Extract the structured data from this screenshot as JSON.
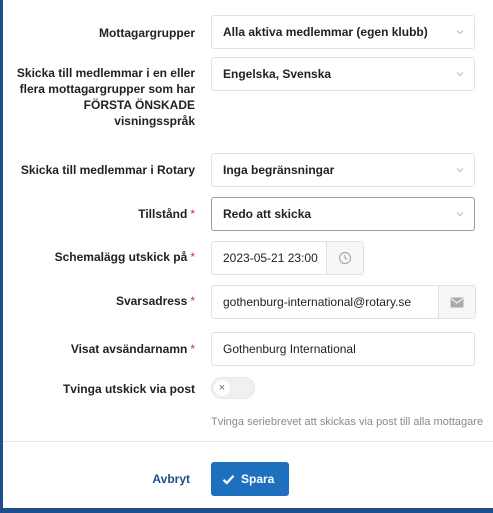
{
  "form": {
    "recipient_groups": {
      "label": "Mottagargrupper",
      "value": "Alla aktiva medlemmar (egen klubb)"
    },
    "language": {
      "label": "Skicka till medlemmar i en eller flera mottagargrupper som har FÖRSTA ÖNSKADE visningsspråk",
      "value": "Engelska, Svenska"
    },
    "rotary_members": {
      "label": "Skicka till medlemmar i Rotary",
      "value": "Inga begränsningar"
    },
    "status": {
      "label": "Tillstånd",
      "required_mark": "*",
      "value": "Redo att skicka"
    },
    "schedule": {
      "label": "Schemalägg utskick på",
      "required_mark": "*",
      "value": "2023-05-21 23:00"
    },
    "reply_address": {
      "label": "Svarsadress",
      "required_mark": "*",
      "value": "gothenburg-international@rotary.se"
    },
    "sender_name": {
      "label": "Visat avsändarnamn",
      "required_mark": "*",
      "value": "Gothenburg International"
    },
    "force_post": {
      "label": "Tvinga utskick via post",
      "toggle_symbol": "×",
      "checked": false,
      "help": "Tvinga seriebrevet att skickas via post till alla mottagare"
    }
  },
  "actions": {
    "cancel_label": "Avbryt",
    "save_label": "Spara"
  },
  "icons": {
    "select_chevron": "chevron-down-icon",
    "schedule_addon": "clock-icon",
    "reply_addon": "envelope-icon",
    "save": "check-icon"
  },
  "colors": {
    "primary": "#1f6fbf",
    "frame": "#1f4e8c",
    "required": "#c0392b",
    "link": "#1f4e8c"
  }
}
